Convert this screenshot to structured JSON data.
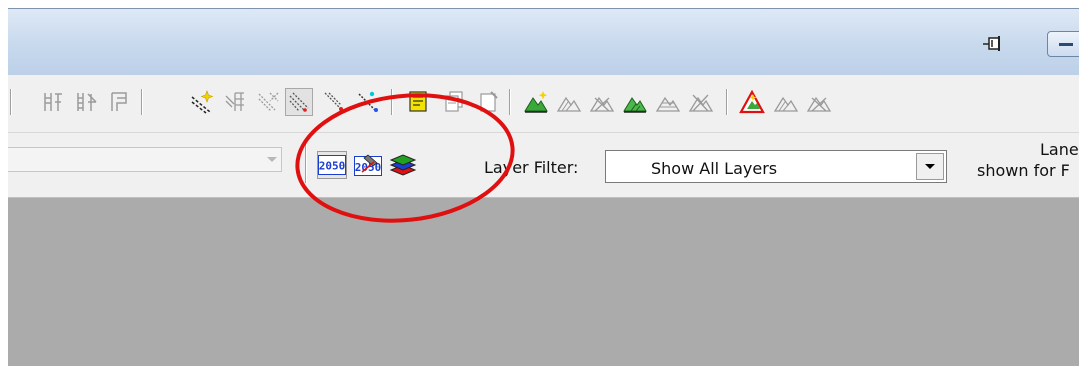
{
  "titlebar": {
    "pin_icon": "pin-icon",
    "minimize_icon": "minimize-icon"
  },
  "toolbar1": {
    "groups": [
      [
        "ladder-icon",
        "ladder-double-icon",
        "ladder-frame-icon"
      ],
      [
        "line-sparkle-icon",
        "line-grid-icon",
        "line-cross-icon"
      ],
      [
        "diagonal-lines-icon",
        "diagonal-dots-icon",
        "diagonal-cyan-icon"
      ],
      [
        "document-yellow-icon",
        "document-stack-icon",
        "document-corner-icon"
      ],
      [
        "mountain-sparkle-icon",
        "mountain-outline-icon",
        "mountain-cross-icon",
        "mountain-green-icon",
        "mountain-grid-icon",
        "mountain-x-icon"
      ],
      [
        "warning-sign-icon",
        "mountain-outline-icon",
        "mountain-cross-icon"
      ]
    ],
    "pressed": "diagonal-lines-icon"
  },
  "toolbar2": {
    "left_combo_value": "",
    "year_button_label": "2050",
    "year_edit_button_label": "2050",
    "layers_icon": "layers-icon",
    "layer_filter_label": "Layer Filter:",
    "layer_filter_value": "Show All Layers",
    "lane_line1": "Lane-B",
    "lane_line2": "shown for F"
  },
  "colors": {
    "titlebar": "#c8d9ed",
    "toolbar": "#f0f0f0",
    "workspace": "#ababab",
    "annotation_circle": "#e01010"
  }
}
